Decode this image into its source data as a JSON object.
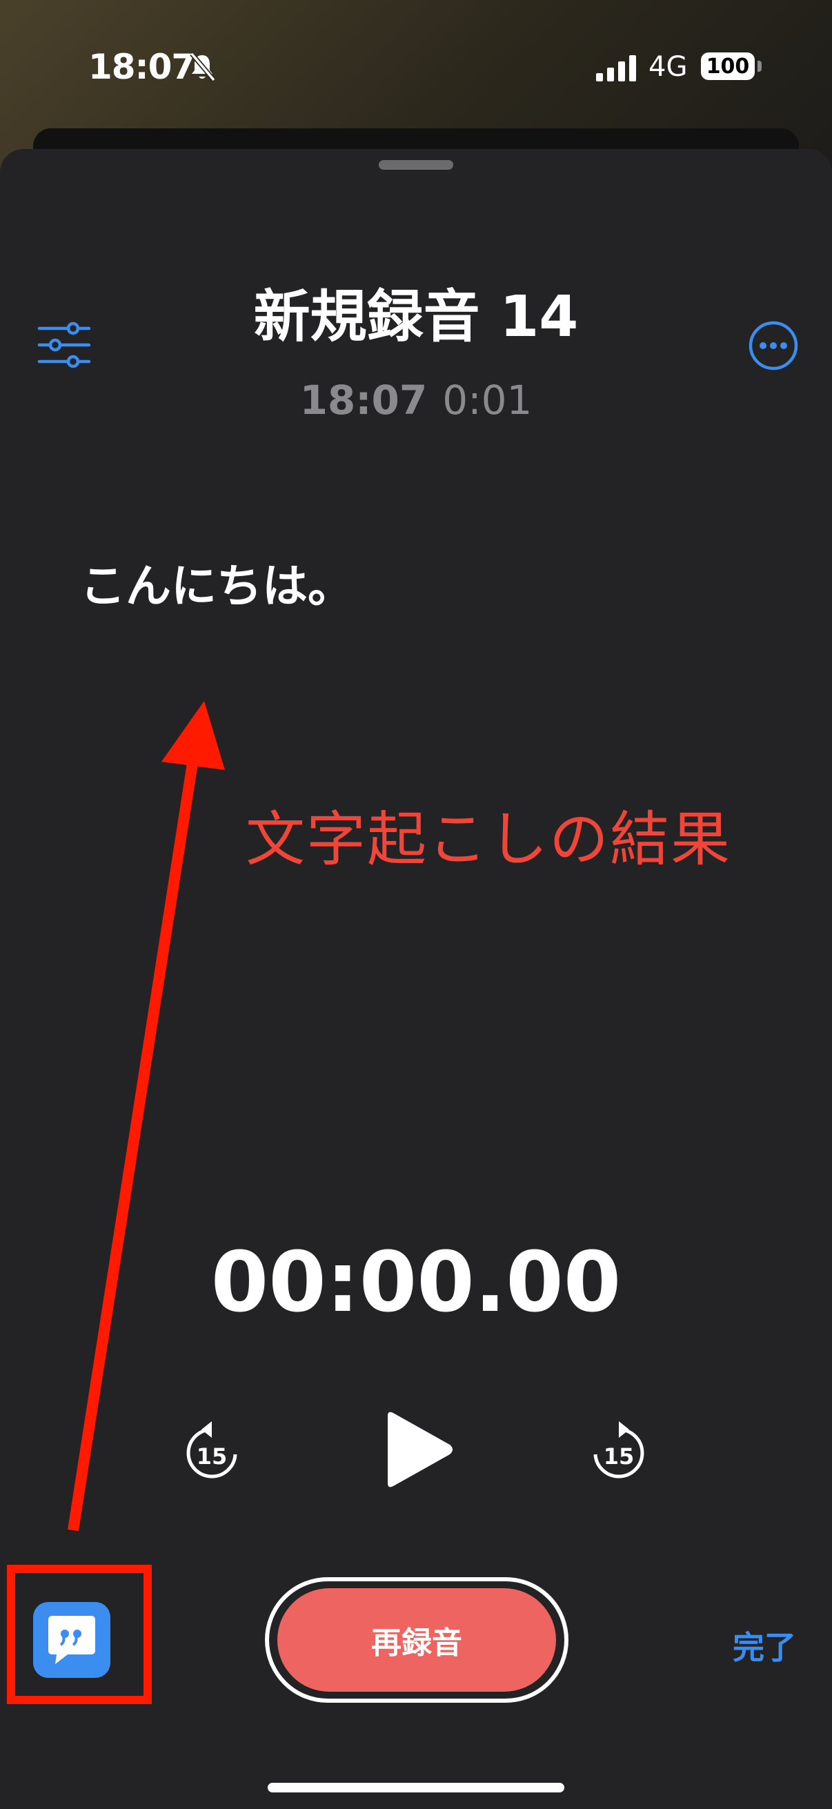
{
  "status_bar": {
    "time": "18:07",
    "network": "4G",
    "battery": "100",
    "icons": [
      "silent-bell-icon",
      "signal-icon",
      "battery-icon"
    ]
  },
  "recording": {
    "title": "新規録音 14",
    "time": "18:07",
    "duration": "0:01"
  },
  "transcript": {
    "text": "こんにちは。"
  },
  "annotation": {
    "label": "文字起こしの結果",
    "color": "#f0463a"
  },
  "player": {
    "timer": "00:00.00",
    "skip_back_seconds": "15",
    "skip_forward_seconds": "15"
  },
  "controls": {
    "rerecord_label": "再録音",
    "done_label": "完了"
  },
  "colors": {
    "accent": "#3b8df0",
    "record": "#ee6461",
    "sheet": "#232326",
    "annotation_red": "#ff1a00"
  }
}
